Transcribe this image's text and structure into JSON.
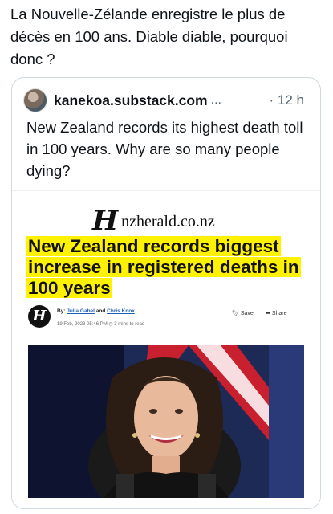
{
  "tweet": {
    "text": "La Nouvelle-Zélande enregistre le plus de décès en 100 ans. Diable diable, pourquoi donc ?"
  },
  "quote": {
    "author": "kanekoa.substack.com",
    "more": "...",
    "time": "· 12 h",
    "text": "New Zealand records its highest death toll in 100 years. Why are so many people dying?"
  },
  "article": {
    "logo_text": "nzherald.co.nz",
    "headline": "New Zealand records biggest increase in registered deaths in 100 years",
    "byline_prefix": "By:",
    "author1": "Julia Gabel",
    "and": "and",
    "author2": "Chris Knox",
    "date": "19 Feb, 2023 05:46 PM",
    "read_time": "3 mins to read",
    "save_label": "Save",
    "share_label": "Share"
  }
}
